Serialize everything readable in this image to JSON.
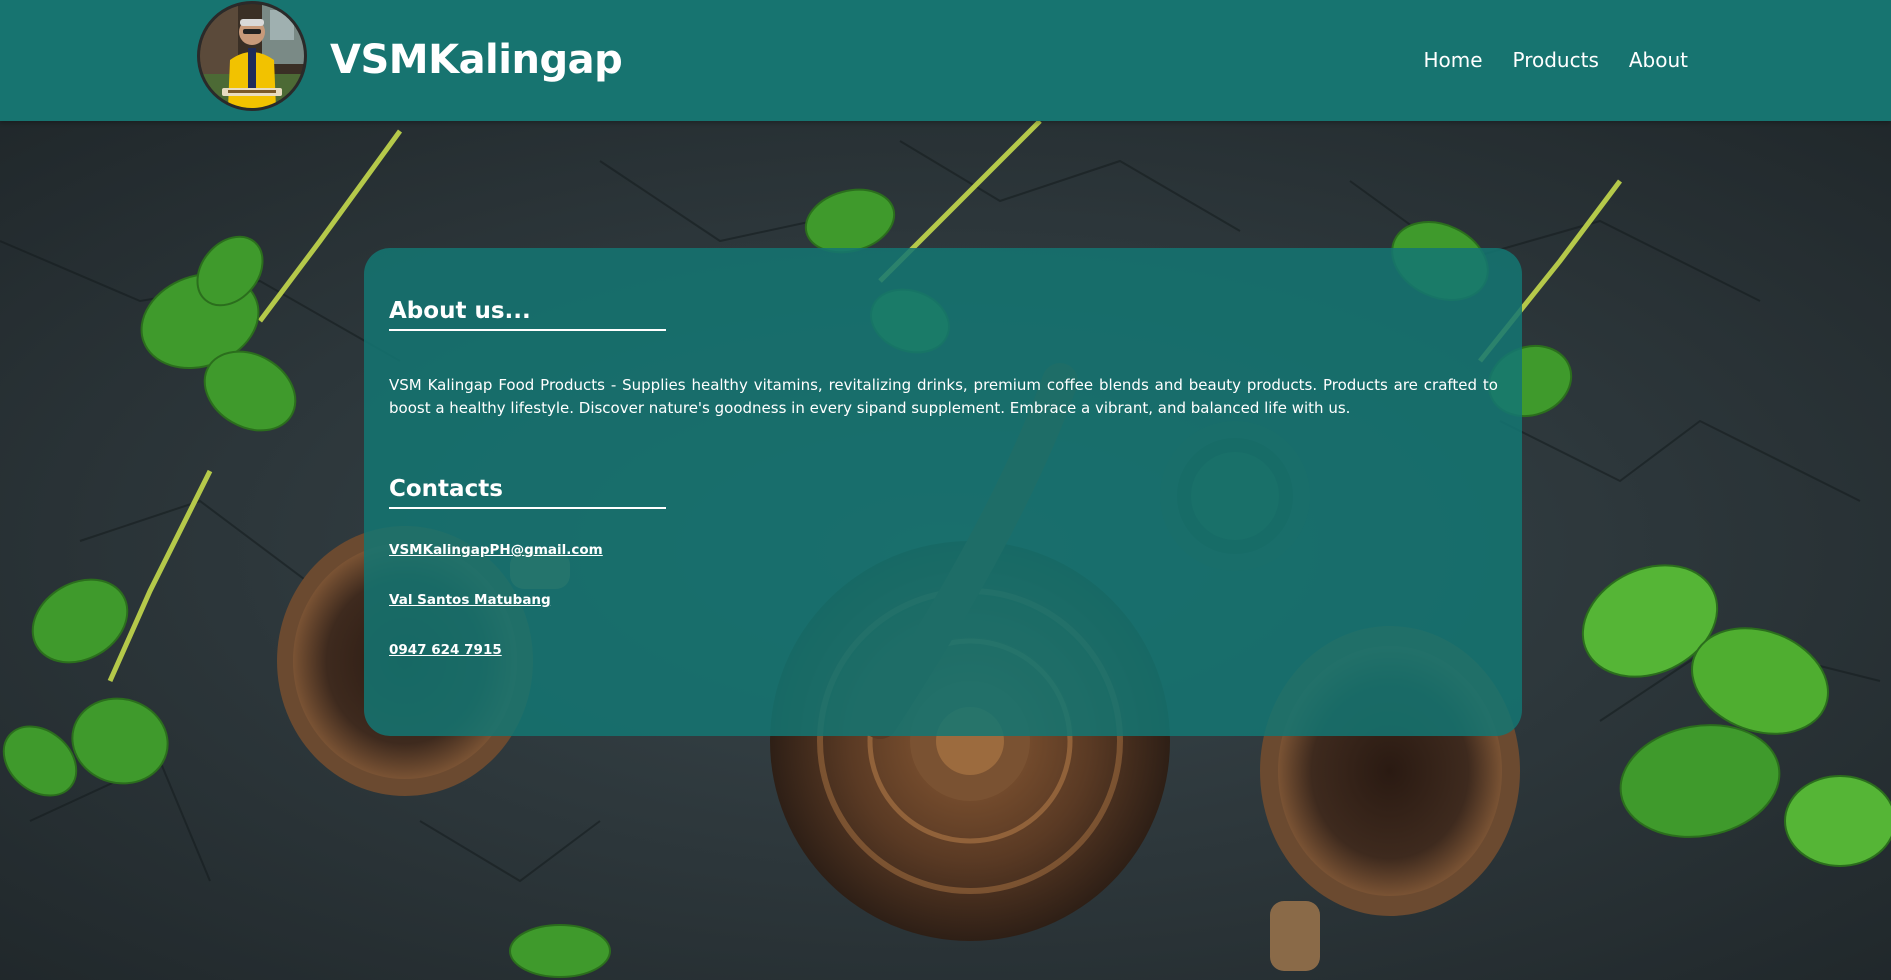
{
  "header": {
    "brand": "VSMKalingap",
    "nav": [
      {
        "label": "Home"
      },
      {
        "label": "Products"
      },
      {
        "label": "About"
      }
    ]
  },
  "about": {
    "title": "About us...",
    "text": "VSM Kalingap Food Products - Supplies healthy vitamins, revitalizing drinks, premium coffee blends and beauty products. Products are crafted to boost a healthy lifestyle. Discover nature's goodness in every sipand supplement. Embrace a vibrant, and balanced life with us."
  },
  "contacts": {
    "title": "Contacts",
    "email": "VSMKalingapPH@gmail.com",
    "name": "Val Santos Matubang",
    "phone": "0947 624 7915"
  },
  "colors": {
    "header_bg": "#177470",
    "card_bg": "#147672",
    "text": "#ffffff"
  }
}
